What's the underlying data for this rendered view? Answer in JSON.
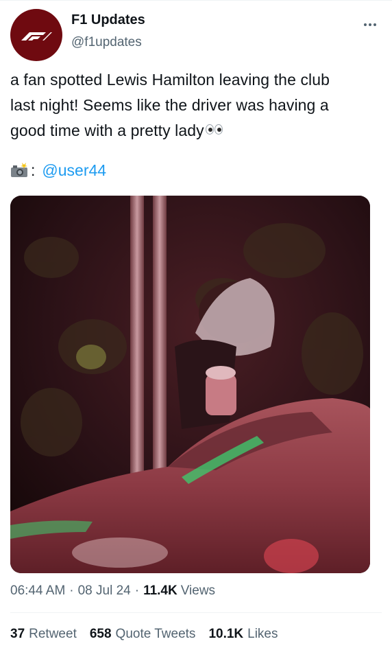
{
  "author": {
    "name": "F1 Updates",
    "handle": "@f1updates",
    "avatar_color": "#6f0a10"
  },
  "tweet": {
    "text_line1": "a fan spotted Lewis Hamilton leaving the club",
    "text_line2": "last night! Seems like the driver was having a",
    "text_line3": "good time with a pretty lady",
    "emoji_eyes": "eyes-emoji",
    "credit_icon": "camera-with-flash-icon",
    "credit_separator": ":",
    "credit_mention": "@user44",
    "mention_color": "#1d9bf0"
  },
  "meta": {
    "time": "06:44 AM",
    "date": "08 Jul 24",
    "views_count": "11.4K",
    "views_label": "Views",
    "separator": "·"
  },
  "stats": {
    "retweets_count": "37",
    "retweets_label": "Retweet",
    "quotes_count": "658",
    "quotes_label": "Quote Tweets",
    "likes_count": "10.1K",
    "likes_label": "Likes"
  },
  "colors": {
    "text_primary": "#0f1419",
    "text_secondary": "#536471",
    "divider": "#eff3f4"
  }
}
